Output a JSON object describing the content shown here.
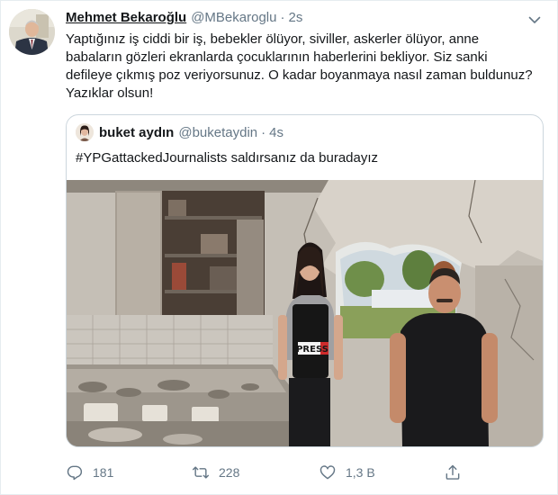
{
  "tweet": {
    "author_name": "Mehmet Bekaroğlu",
    "author_handle": "@MBekaroglu",
    "separator": "·",
    "time": "2s",
    "text_lines": [
      "Yaptığınız iş ciddi bir iş, bebekler ölüyor, siviller, askerler ölüyor, anne",
      "babaların gözleri ekranlarda çocuklarının haberlerini bekliyor. Siz sanki",
      "defileye çıkmış poz veriyorsunuz. O kadar boyanmaya nasıl zaman buldunuz?",
      "Yazıklar olsun!"
    ]
  },
  "quoted_tweet": {
    "author_name": "buket aydın",
    "author_handle": "@buketaydin",
    "separator": "·",
    "time": "4s",
    "text": "#YPGattackedJournalists saldırsanız  da buradayız",
    "media_vest_text": "PRESS"
  },
  "actions": {
    "reply_count": "181",
    "retweet_count": "228",
    "like_count": "1,3 B"
  },
  "icons": {
    "caret": "chevron-down-icon",
    "reply": "reply-icon",
    "retweet": "retweet-icon",
    "like": "heart-icon",
    "share": "share-icon"
  },
  "colors": {
    "text_primary": "#14171a",
    "text_secondary": "#657786",
    "border": "#e6ecf0",
    "quote_border": "#ccd6dd"
  }
}
